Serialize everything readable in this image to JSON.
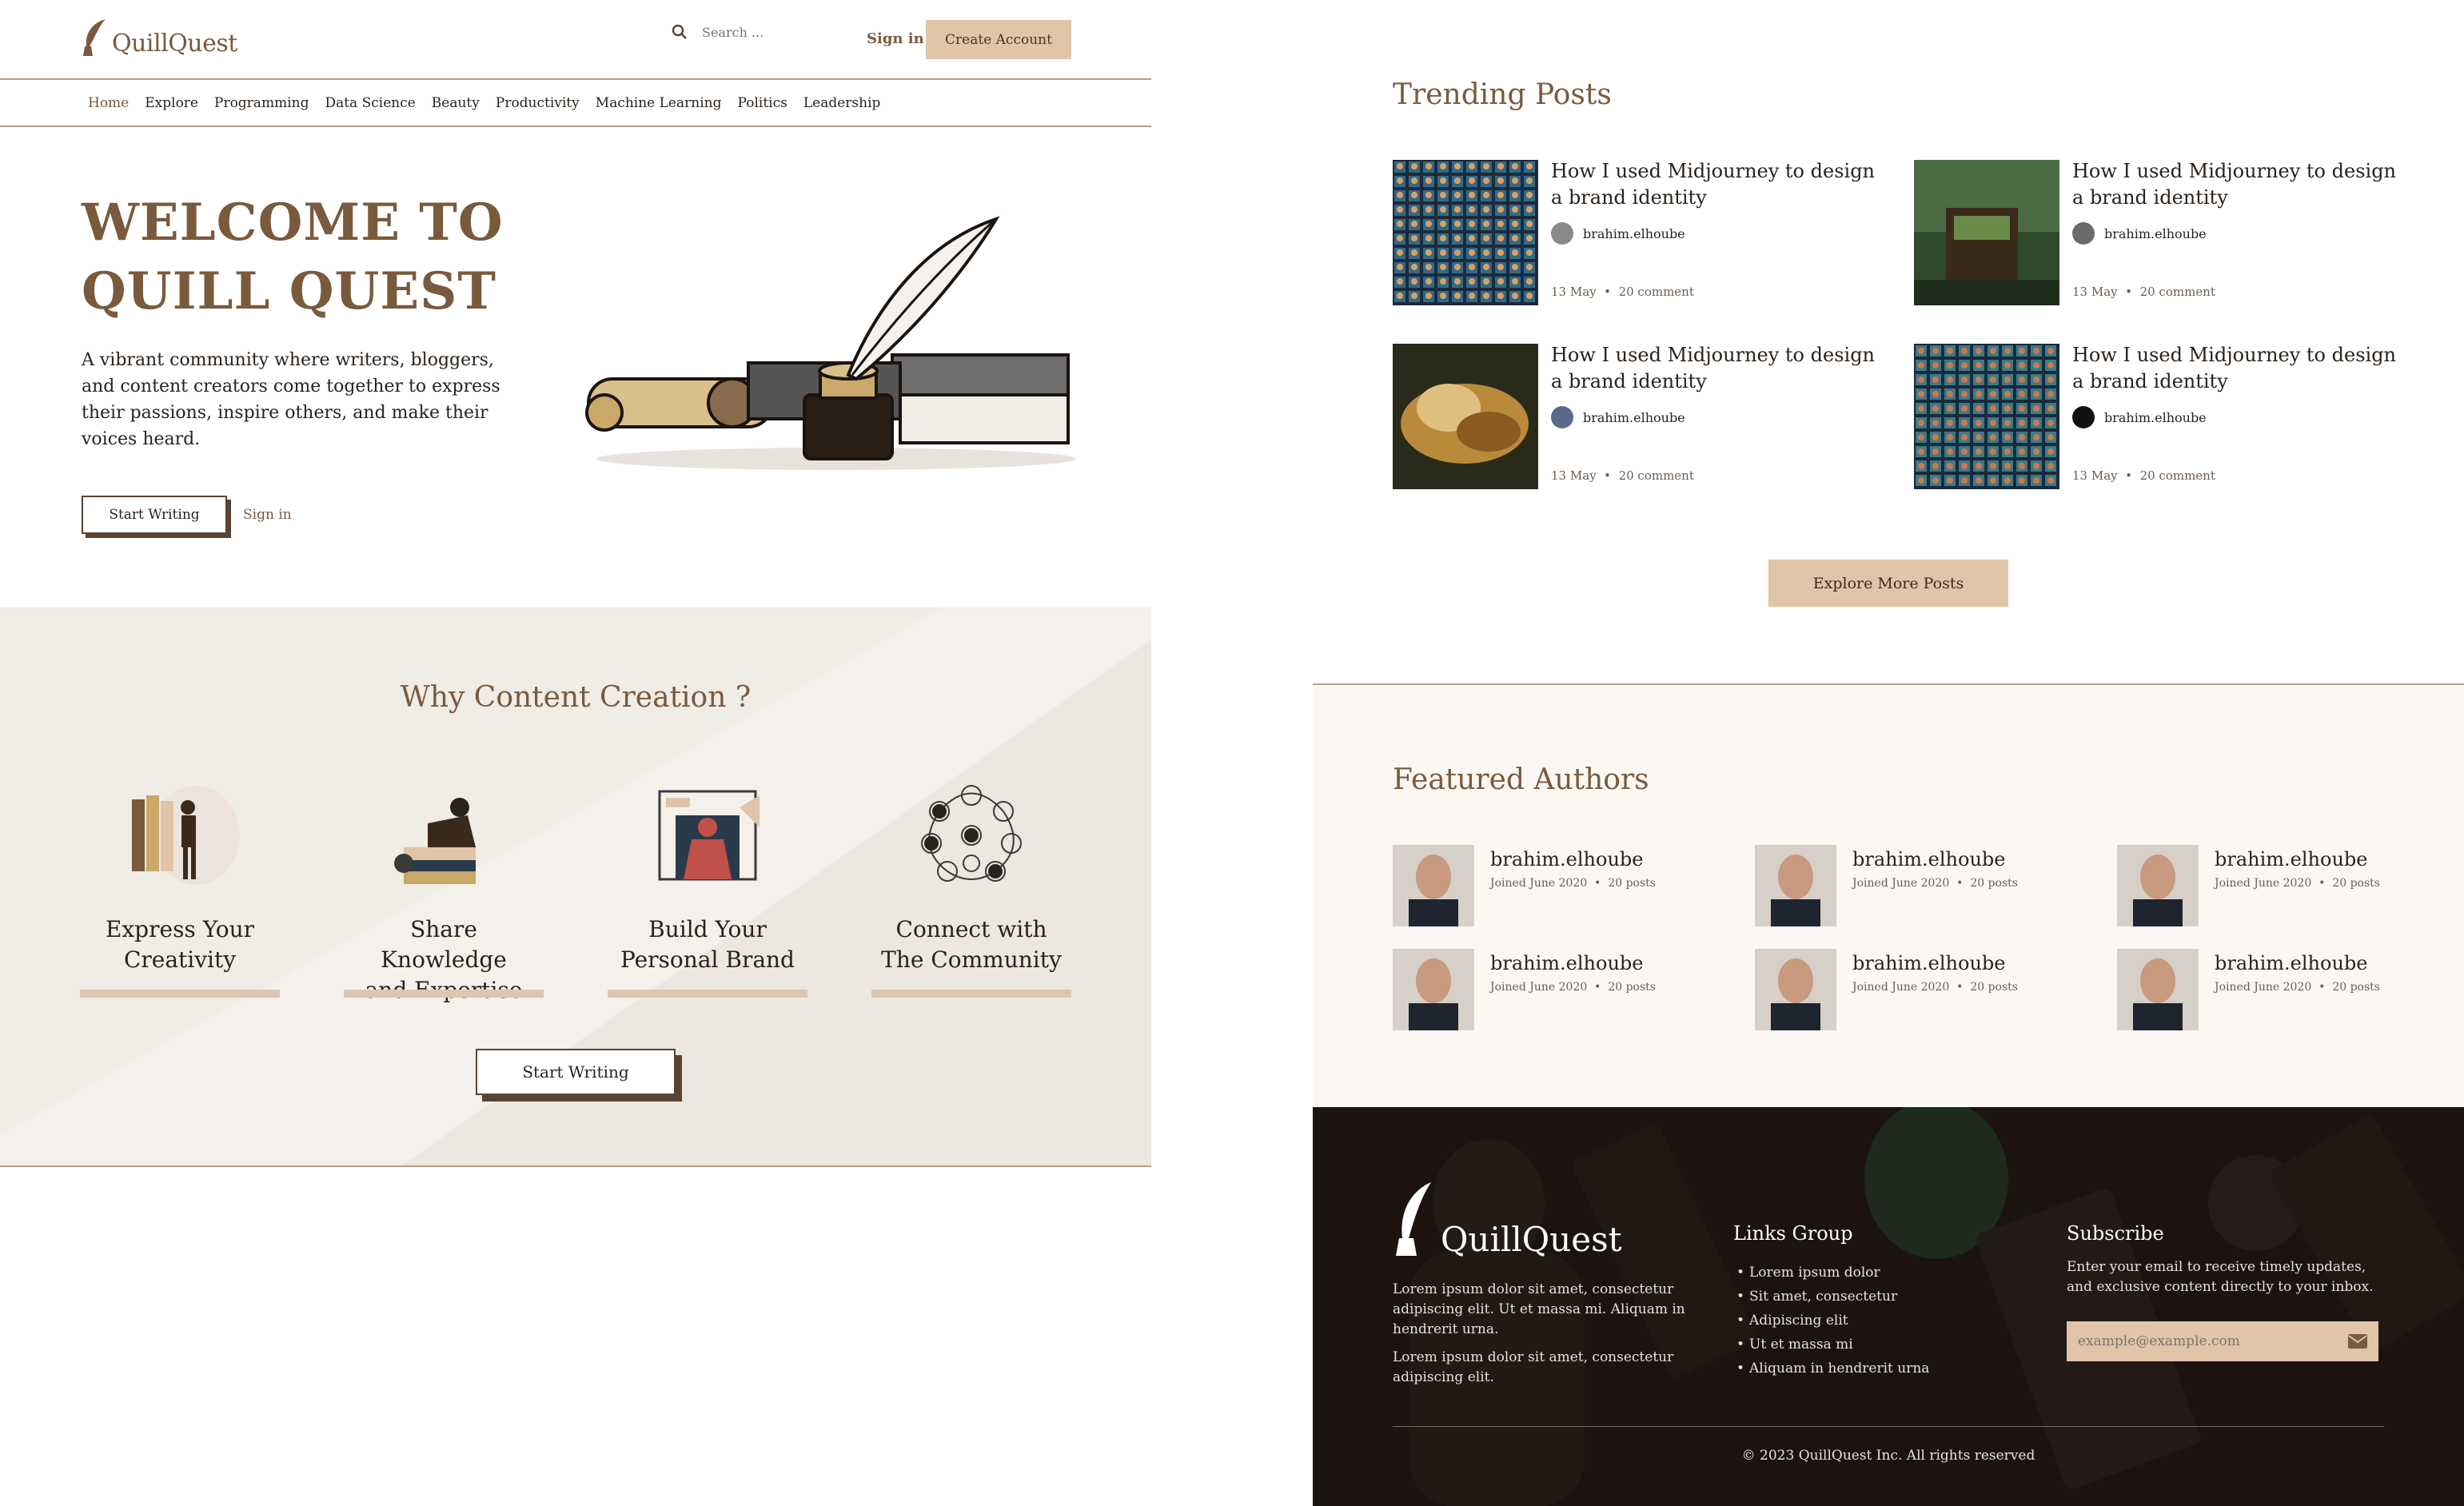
{
  "brand": {
    "name": "QuillQuest"
  },
  "header": {
    "search_placeholder": "Search ...",
    "signin_label": "Sign in",
    "create_account_label": "Create Account"
  },
  "nav": {
    "items": [
      {
        "label": "Home",
        "active": true
      },
      {
        "label": "Explore"
      },
      {
        "label": "Programming"
      },
      {
        "label": "Data Science"
      },
      {
        "label": "Beauty"
      },
      {
        "label": "Productivity"
      },
      {
        "label": "Machine Learning"
      },
      {
        "label": "Politics"
      },
      {
        "label": "Leadership"
      }
    ]
  },
  "hero": {
    "title_line1": "WELCOME TO",
    "title_line2": "QUILL QUEST",
    "description": "A vibrant community where writers, bloggers, and content creators come together to express their passions, inspire others, and make their voices heard.",
    "start_writing_label": "Start Writing",
    "signin_label": "Sign in"
  },
  "why": {
    "title": "Why Content Creation ?",
    "cards": [
      {
        "line1": "Express Your",
        "line2": "Creativity"
      },
      {
        "line1": "Share Knowledge",
        "line2": "and Expertise"
      },
      {
        "line1": "Build Your",
        "line2": "Personal Brand"
      },
      {
        "line1": "Connect with",
        "line2": "The Community"
      }
    ],
    "start_writing_label": "Start Writing"
  },
  "trending": {
    "title": "Trending Posts",
    "posts": [
      {
        "title": "How I used Midjourney to design a brand identity",
        "author": "brahim.elhoube",
        "date": "13 May",
        "comments": "20 comment"
      },
      {
        "title": "How I used Midjourney to design a brand identity",
        "author": "brahim.elhoube",
        "date": "13 May",
        "comments": "20 comment"
      },
      {
        "title": "How I used Midjourney to design a brand identity",
        "author": "brahim.elhoube",
        "date": "13 May",
        "comments": "20 comment"
      },
      {
        "title": "How I used Midjourney to design a brand identity",
        "author": "brahim.elhoube",
        "date": "13 May",
        "comments": "20 comment"
      }
    ],
    "explore_label": "Explore More Posts"
  },
  "featured": {
    "title": "Featured Authors",
    "authors": [
      {
        "name": "brahim.elhoube",
        "joined": "Joined June 2020",
        "posts": "20 posts"
      },
      {
        "name": "brahim.elhoube",
        "joined": "Joined June 2020",
        "posts": "20 posts"
      },
      {
        "name": "brahim.elhoube",
        "joined": "Joined June 2020",
        "posts": "20 posts"
      },
      {
        "name": "brahim.elhoube",
        "joined": "Joined June 2020",
        "posts": "20 posts"
      },
      {
        "name": "brahim.elhoube",
        "joined": "Joined June 2020",
        "posts": "20 posts"
      },
      {
        "name": "brahim.elhoube",
        "joined": "Joined June 2020",
        "posts": "20 posts"
      }
    ]
  },
  "footer": {
    "brand": "QuillQuest",
    "desc1": "Lorem ipsum dolor sit amet, consectetur adipiscing elit. Ut et massa mi. Aliquam in hendrerit urna.",
    "desc2": "Lorem ipsum dolor sit amet, consectetur adipiscing elit.",
    "links_title": "Links Group",
    "links": [
      "Lorem ipsum dolor",
      "Sit amet, consectetur",
      "Adipiscing elit",
      "Ut et massa mi",
      "Aliquam in hendrerit urna"
    ],
    "subscribe_title": "Subscribe",
    "subscribe_text": "Enter your email to receive timely updates, and exclusive content directly to your inbox.",
    "email_placeholder": "example@example.com",
    "copyright": "© 2023 QuillQuest Inc. All rights reserved"
  },
  "colors": {
    "accent": "#7a5a3c",
    "button": "#e2c4a8",
    "footer_bg": "#1c1310",
    "section_bg": "#f4f1ec"
  },
  "icons": [
    "quill-logo-icon",
    "search-icon",
    "mail-icon"
  ]
}
